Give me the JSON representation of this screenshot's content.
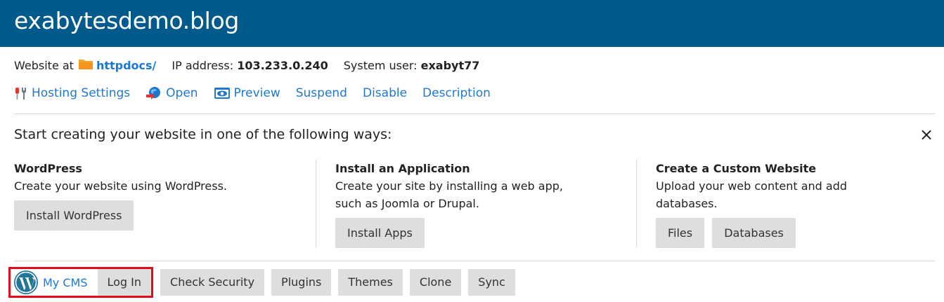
{
  "header": {
    "title": "exabytesdemo.blog",
    "bg_color": "#005a8c"
  },
  "info": {
    "website_at_label": "Website at",
    "folder_link": "httpdocs/",
    "ip_label": "IP address:",
    "ip_value": "103.233.0.240",
    "system_user_label": "System user:",
    "system_user_value": "exabyt77"
  },
  "actions": [
    {
      "label": "Hosting Settings",
      "icon": "hosting-settings-icon"
    },
    {
      "label": "Open",
      "icon": "open-icon"
    },
    {
      "label": "Preview",
      "icon": "preview-icon"
    },
    {
      "label": "Suspend"
    },
    {
      "label": "Disable"
    },
    {
      "label": "Description"
    }
  ],
  "start": {
    "title": "Start creating your website in one of the following ways:",
    "close_symbol": "×",
    "columns": [
      {
        "heading": "WordPress",
        "desc_lines": [
          "Create your website using WordPress."
        ],
        "buttons": [
          "Install WordPress"
        ]
      },
      {
        "heading": "Install an Application",
        "desc_lines": [
          "Create your site by installing a web app,",
          "such as Joomla or Drupal."
        ],
        "buttons": [
          "Install Apps"
        ]
      },
      {
        "heading": "Create a Custom Website",
        "desc_lines": [
          "Upload your web content and add",
          "databases."
        ],
        "buttons": [
          "Files",
          "Databases"
        ]
      }
    ]
  },
  "bottom": {
    "cms_label": "My CMS",
    "login_label": "Log In",
    "buttons": [
      "Check Security",
      "Plugins",
      "Themes",
      "Clone",
      "Sync"
    ],
    "highlight_color": "#e20c1b"
  },
  "colors": {
    "link": "#1e78d2",
    "button_bg": "#dedede"
  }
}
